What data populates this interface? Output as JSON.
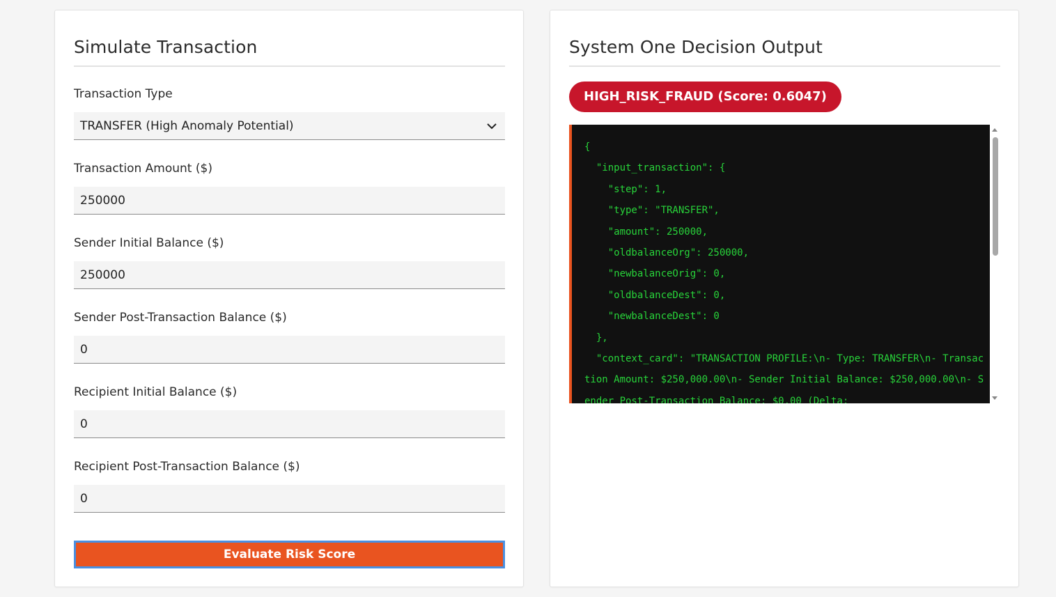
{
  "simulate": {
    "title": "Simulate Transaction",
    "fields": [
      {
        "label": "Transaction Type",
        "value": "TRANSFER (High Anomaly Potential)",
        "kind": "select"
      },
      {
        "label": "Transaction Amount ($)",
        "value": "250000",
        "kind": "input"
      },
      {
        "label": "Sender Initial Balance ($)",
        "value": "250000",
        "kind": "input"
      },
      {
        "label": "Sender Post-Transaction Balance ($)",
        "value": "0",
        "kind": "input"
      },
      {
        "label": "Recipient Initial Balance ($)",
        "value": "0",
        "kind": "input"
      },
      {
        "label": "Recipient Post-Transaction Balance ($)",
        "value": "0",
        "kind": "input"
      }
    ],
    "button_label": "Evaluate Risk Score"
  },
  "output": {
    "title": "System One Decision Output",
    "badge_text": "HIGH_RISK_FRAUD (Score: 0.6047)",
    "badge_color": "#c7162b",
    "json_text": "{\n  \"input_transaction\": {\n    \"step\": 1,\n    \"type\": \"TRANSFER\",\n    \"amount\": 250000,\n    \"oldbalanceOrg\": 250000,\n    \"newbalanceOrig\": 0,\n    \"oldbalanceDest\": 0,\n    \"newbalanceDest\": 0\n  },\n  \"context_card\": \"TRANSACTION PROFILE:\\n- Type: TRANSFER\\n- Transaction Amount: $250,000.00\\n- Sender Initial Balance: $250,000.00\\n- Sender Post-Transaction Balance: $0.00 (Delta:"
  },
  "colors": {
    "accent": "#e95420",
    "code_text": "#28d43a",
    "code_bg": "#111111"
  }
}
